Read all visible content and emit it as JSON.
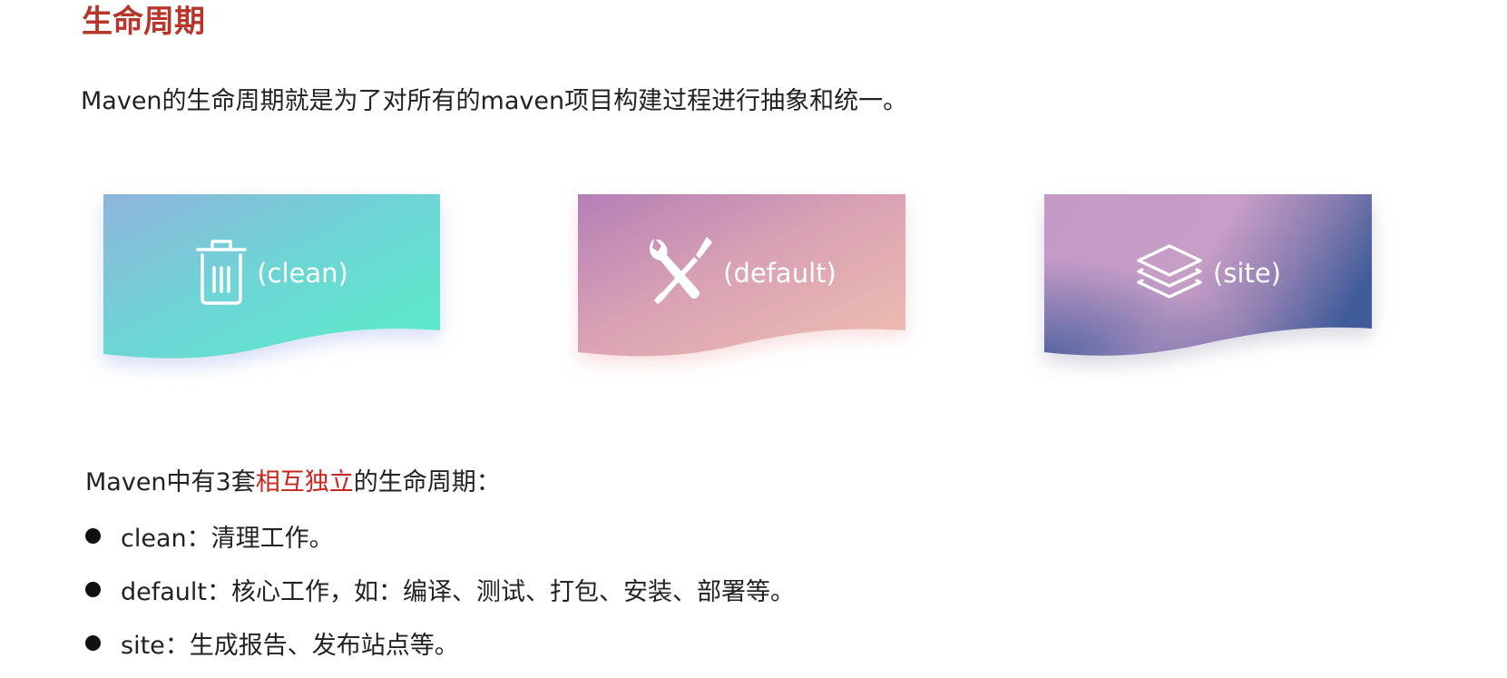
{
  "title": "生命周期",
  "intro": "Maven的生命周期就是为了对所有的maven项目构建过程进行抽象和统一。",
  "cards": [
    {
      "label": "(clean)",
      "icon": "trash-icon"
    },
    {
      "label": "(default)",
      "icon": "wrench-screwdriver-icon"
    },
    {
      "label": "(site)",
      "icon": "layers-icon"
    }
  ],
  "summary": {
    "prefix": "Maven中有3套",
    "highlight": "相互独立",
    "suffix": "的生命周期："
  },
  "bullets": [
    {
      "text": "clean：清理工作。"
    },
    {
      "text": "default：核心工作，如：编译、测试、打包、安装、部署等。"
    },
    {
      "text": "site：生成报告、发布站点等。"
    }
  ],
  "colors": {
    "title": "#b8352c",
    "highlight": "#c8251c",
    "clean_gradient": [
      "#8fb4dc",
      "#5ceccb"
    ],
    "default_gradient": [
      "#b784b9",
      "#efbcb0"
    ],
    "site_gradient": [
      "#c59bc6",
      "#3f5c99"
    ]
  }
}
